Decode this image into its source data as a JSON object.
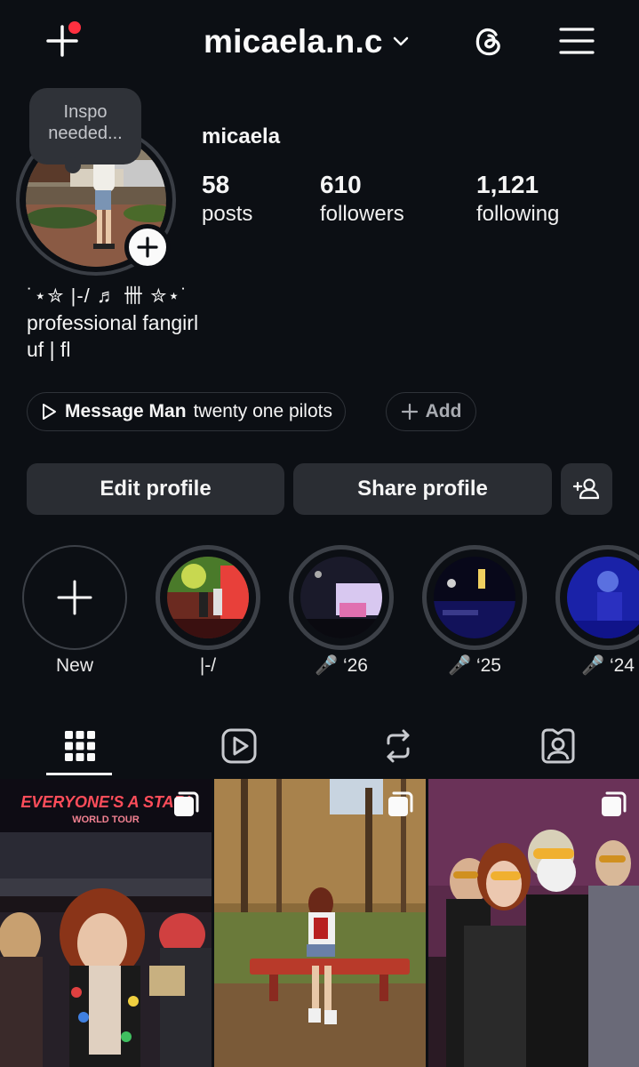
{
  "header": {
    "username": "micaela.n.c",
    "create_icon": "plus-icon",
    "notification_dot_color": "#ff3040",
    "dropdown_icon": "chevron-down-icon",
    "threads_icon": "threads-icon",
    "menu_icon": "hamburger-menu-icon"
  },
  "profile": {
    "note_text": "Inspo needed...",
    "display_name": "micaela",
    "stats": {
      "posts": {
        "count": "58",
        "label": "posts"
      },
      "followers": {
        "count": "610",
        "label": "followers"
      },
      "following": {
        "count": "1,121",
        "label": "following"
      }
    },
    "bio": {
      "line1": "˙⋆✮ |-/ ♬ 卌 ✮⋆˙",
      "line2": "professional fangirl",
      "line3": "uf | fl"
    },
    "music": {
      "song": "Message Man",
      "artist": "twenty one pilots"
    },
    "add_label": "Add"
  },
  "actions": {
    "edit_profile": "Edit profile",
    "share_profile": "Share profile"
  },
  "highlights": [
    {
      "label": "New"
    },
    {
      "label": "|-/"
    },
    {
      "label": "🎤 ‘26"
    },
    {
      "label": "🎤 ‘25"
    },
    {
      "label": "🎤 ‘24"
    }
  ],
  "tabs": [
    "grid-icon",
    "reels-icon",
    "reposts-icon",
    "tagged-icon"
  ],
  "posts": [
    {
      "overlay_text_1": "EVERYONE'S A STAR!",
      "overlay_text_2": "WORLD TOUR",
      "badge_icon": "carousel-icon"
    },
    {
      "badge_icon": "carousel-icon"
    },
    {
      "badge_icon": "carousel-icon"
    }
  ]
}
